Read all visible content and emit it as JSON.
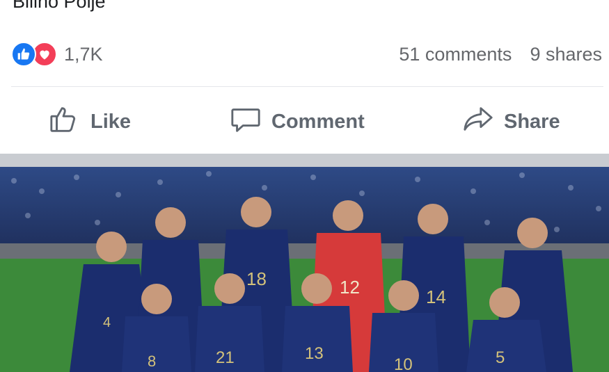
{
  "post": {
    "title": "Bilino Polje"
  },
  "reactions": {
    "count": "1,7K",
    "types": [
      "like-icon",
      "love-icon"
    ]
  },
  "stats": {
    "comments": "51 comments",
    "shares": "9 shares"
  },
  "actions": {
    "like": "Like",
    "comment": "Comment",
    "share": "Share"
  },
  "photo": {
    "jersey_numbers": [
      "4",
      "18",
      "12",
      "14",
      "8",
      "21",
      "13",
      "10",
      "5"
    ]
  },
  "colors": {
    "like": "#1877f2",
    "love": "#f33e58",
    "action_text": "#606770",
    "jersey": "#1b2d6e",
    "keeper": "#d63a3a",
    "pitch": "#3c8a3a"
  }
}
